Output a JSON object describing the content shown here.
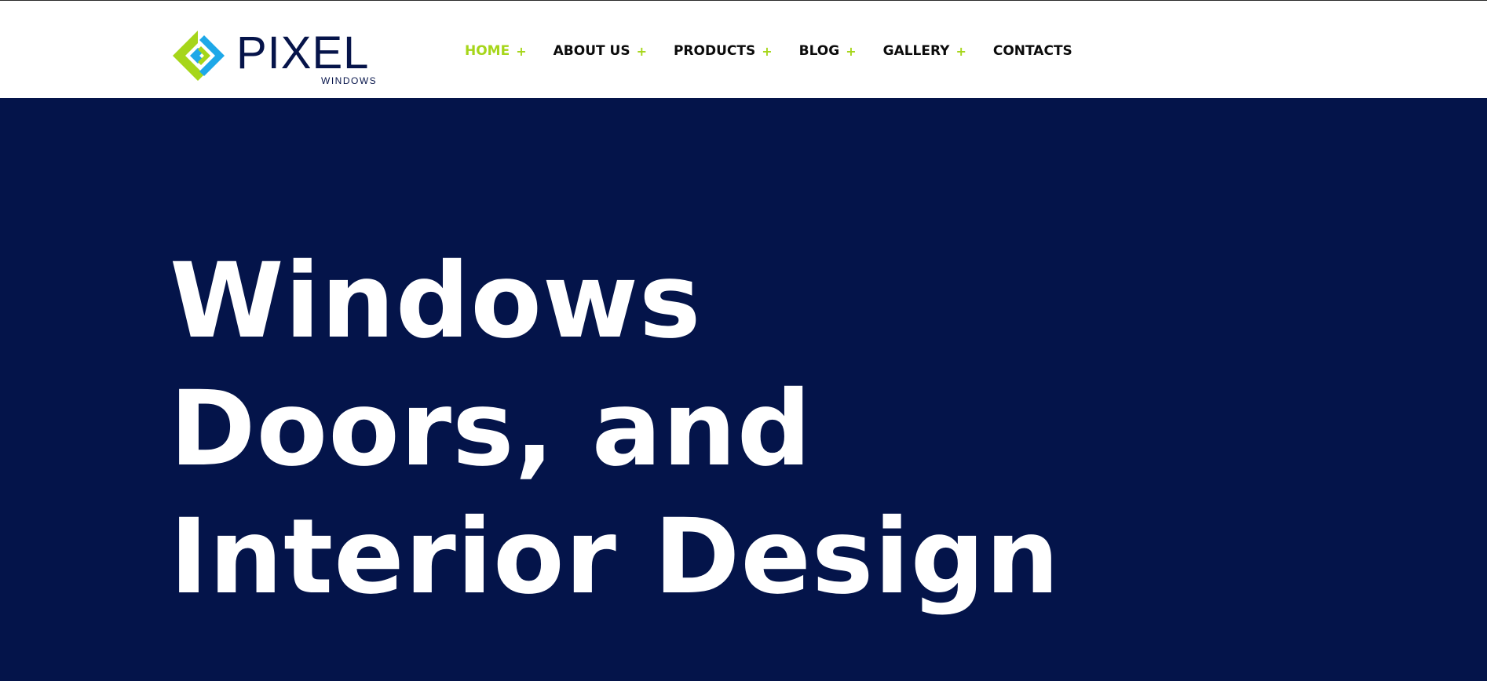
{
  "brand": {
    "name": "PIXEL",
    "sub": "WINDOWS",
    "colors": {
      "navy": "#04144a",
      "lime": "#a6d61a",
      "sky": "#1ea8e8"
    }
  },
  "nav": {
    "items": [
      {
        "label": "HOME",
        "has_submenu": true,
        "active": true
      },
      {
        "label": "ABOUT US",
        "has_submenu": true,
        "active": false
      },
      {
        "label": "PRODUCTS",
        "has_submenu": true,
        "active": false
      },
      {
        "label": "BLOG",
        "has_submenu": true,
        "active": false
      },
      {
        "label": "GALLERY",
        "has_submenu": true,
        "active": false
      },
      {
        "label": "CONTACTS",
        "has_submenu": false,
        "active": false
      }
    ],
    "submenu_icon": "plus-icon"
  },
  "hero": {
    "title_lines": [
      "Windows",
      "Doors, and",
      "Interior Design"
    ]
  }
}
